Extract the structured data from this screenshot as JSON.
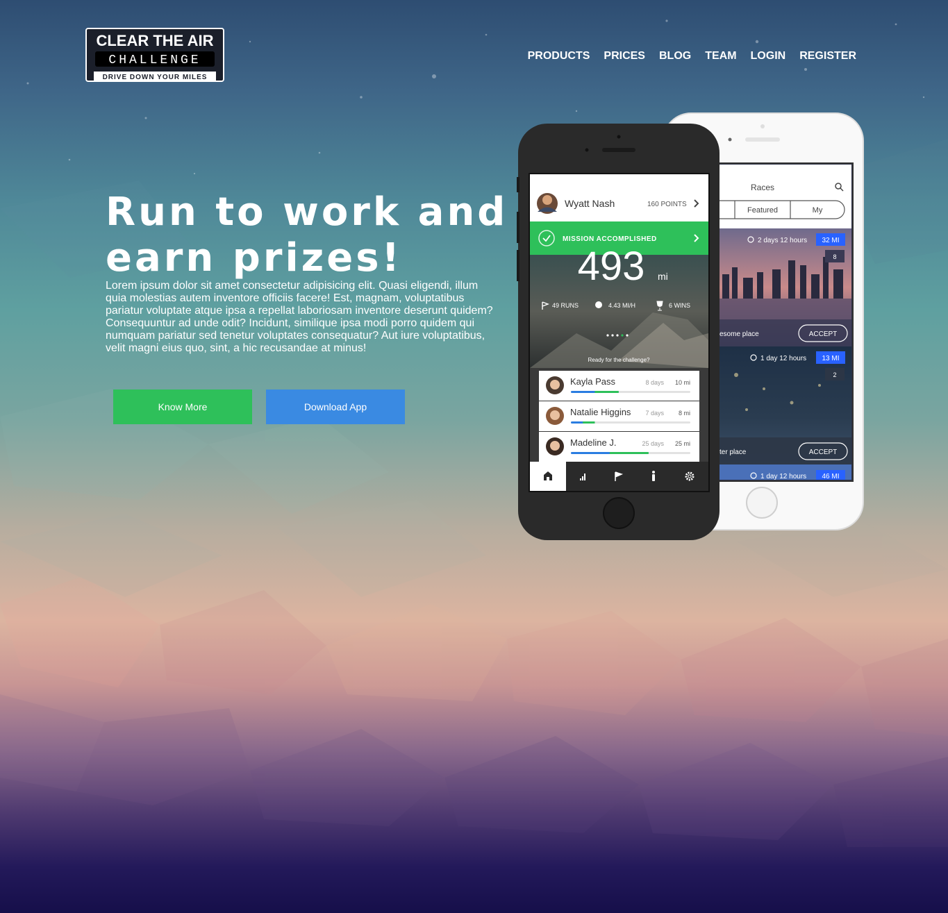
{
  "logo": {
    "line1": "CLEAR THE AIR",
    "line2": "CHALLENGE",
    "tagline": "DRIVE DOWN YOUR MILES"
  },
  "nav": {
    "items": [
      "PRODUCTS",
      "PRICES",
      "BLOG",
      "TEAM",
      "LOGIN",
      "REGISTER"
    ]
  },
  "hero": {
    "headline": "Run to work and earn prizes!",
    "body": "Lorem ipsum dolor sit amet consectetur adipisicing elit. Quasi eligendi, illum quia molestias autem inventore officiis facere! Est, magnam, voluptatibus pariatur voluptate atque ipsa a repellat laboriosam inventore deserunt quidem? Consequuntur ad unde odit? Incidunt, similique ipsa modi porro quidem qui numquam pariatur sed tenetur voluptates consequatur? Aut iure voluptatibus, velit magni eius quo, sint, a hic recusandae at minus!",
    "know_more_label": "Know More",
    "download_label": "Download App"
  },
  "phone_front": {
    "user_name": "Wyatt Nash",
    "points": "160 POINTS",
    "banner": "MISSION ACCOMPLISHED",
    "big_number": "493",
    "big_unit": "mi",
    "stats": [
      "49 RUNS",
      "4.43 MI/H",
      "6 WINS"
    ],
    "prompt": "Ready for the challenge?",
    "leaderboard": [
      {
        "name": "Kayla Pass",
        "days": "8 days",
        "miles": "10 mi",
        "progress": 0.4
      },
      {
        "name": "Natalie Higgins",
        "days": "7 days",
        "miles": "8 mi",
        "progress": 0.2
      },
      {
        "name": "Madeline J.",
        "days": "25 days",
        "miles": "25 mi",
        "progress": 0.65
      }
    ],
    "tab_icons": [
      "home-icon",
      "signal-icon",
      "flag-icon",
      "runner-icon",
      "gear-icon"
    ]
  },
  "phone_back": {
    "title": "Races",
    "tabs": [
      "Featured",
      "My"
    ],
    "races": [
      {
        "time": "2 days 12 hours",
        "distance": "32 MI",
        "participants": "8",
        "place": "esome place",
        "action": "ACCEPT"
      },
      {
        "time": "1 day 12 hours",
        "distance": "13 MI",
        "participants": "2",
        "place": "ter place",
        "action": "ACCEPT"
      },
      {
        "time": "1 day 12 hours",
        "distance": "46 MI"
      }
    ]
  },
  "colors": {
    "accent_green": "#2ec05a",
    "accent_blue": "#3a8ae2",
    "phone_dark": "#2a2a2a"
  }
}
